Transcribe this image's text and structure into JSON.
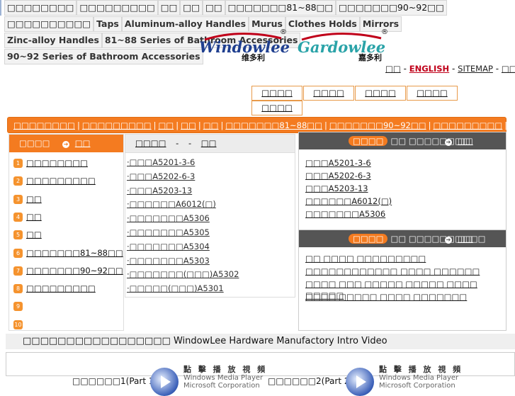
{
  "top_tags": [
    {
      "label": "□□□□□□□□",
      "bold": false
    },
    {
      "label": "□□□□□□□□□",
      "bold": false
    },
    {
      "label": "□□",
      "bold": false
    },
    {
      "label": "□□",
      "bold": false
    },
    {
      "label": "□□",
      "bold": false
    },
    {
      "label": "□□□□□□□81~88□□",
      "bold": false
    },
    {
      "label": "□□□□□□□90~92□□",
      "bold": false
    },
    {
      "label": "□□□□□□□□□□",
      "bold": false
    },
    {
      "label": "Taps",
      "bold": true
    },
    {
      "label": "Aluminum-alloy Handles",
      "bold": true
    },
    {
      "label": "Murus",
      "bold": true
    },
    {
      "label": "Clothes Holds",
      "bold": true
    },
    {
      "label": "Mirrors",
      "bold": true
    },
    {
      "label": "Zinc-alloy Handles",
      "bold": true
    },
    {
      "label": "81~88 Series of Bathroom Accessories",
      "bold": true
    },
    {
      "label": "90~92 Series of Bathroom Accessories",
      "bold": true
    }
  ],
  "logos": {
    "windowlee": "Windowlee",
    "windowlee_cn": "维多利",
    "gardowlee": "Gardowlee",
    "gardowlee_cn": "嘉多利",
    "registered": "®"
  },
  "lang_links": {
    "chinese": "□□",
    "english": "ENGLISH",
    "sitemap": "SITEMAP",
    "last": "□□□□",
    "sep": "-"
  },
  "nav_buttons": [
    "□□□□",
    "□□□□",
    "□□□□",
    "□□□□",
    "□□□□"
  ],
  "menubar": [
    "□□□□□□□□",
    "□□□□□□□□□",
    "□□",
    "□□",
    "□□",
    "□□□□□□□81~88□□",
    "□□□□□□□90~92□□",
    "□□□□□□□□□"
  ],
  "categories": {
    "header": "□□□□",
    "header_link": "□□",
    "items": [
      {
        "num": "1",
        "label": "□□□□□□□□"
      },
      {
        "num": "2",
        "label": "□□□□□□□□□"
      },
      {
        "num": "3",
        "label": "□□"
      },
      {
        "num": "4",
        "label": "□□"
      },
      {
        "num": "5",
        "label": "□□"
      },
      {
        "num": "6",
        "label": "□□□□□□□81~88□□"
      },
      {
        "num": "7",
        "label": "□□□□□□□90~92□□"
      },
      {
        "num": "8",
        "label": "□□□□□□□□□"
      },
      {
        "num": "9",
        "label": ""
      },
      {
        "num": "10",
        "label": ""
      }
    ]
  },
  "product_list": {
    "header_a": "□□□□",
    "header_sep": "-",
    "header_b": "□□",
    "items": [
      "·□□□A5201-3-6",
      "·□□□A5202-6-3",
      "·□□□A5203-13",
      "·□□□□□□A6012(□)",
      "·□□□□□□□A5306",
      "·□□□□□□□A5305",
      "·□□□□□□□A5304",
      "·□□□□□□□A5303",
      "·□□□□□□□(□□□)A5302",
      "·□□□□□(□□□)A5301"
    ]
  },
  "new_products": {
    "pill": "□□□□",
    "title": "□□ □□□□□□□□",
    "more": "□□",
    "items": [
      "□□□A5201-3-6",
      "□□□A5202-6-3",
      "□□□A5203-13",
      "□□□□□□A6012(□)",
      "□□□□□□□A5306"
    ]
  },
  "news": {
    "pill": "□□□□",
    "title": "□□ □□□□□□□□□□",
    "more": "□□",
    "items": [
      "□□ □□□□ □□□□□□□□□",
      "□□□□□□□□□□□□ □□□□ □□□□□□",
      "□□□□ □□□ □□□□□ □□□□□ □□□□ □□□□□",
      "□□□□ □□□□□ □□□□ □□□□□□□"
    ]
  },
  "video": {
    "title": "□□□□□□□□□□□□□□□□□  WindowLee Hardware Manufactory Intro Video",
    "part1": "□□□□□□1(Part 1):",
    "part2": "□□□□□□2(Part 2):",
    "wmp_cn": "點 擊 播 放 視 頻",
    "wmp_name": "Windows Media Player",
    "wmp_corp": "Microsoft Corporation"
  }
}
